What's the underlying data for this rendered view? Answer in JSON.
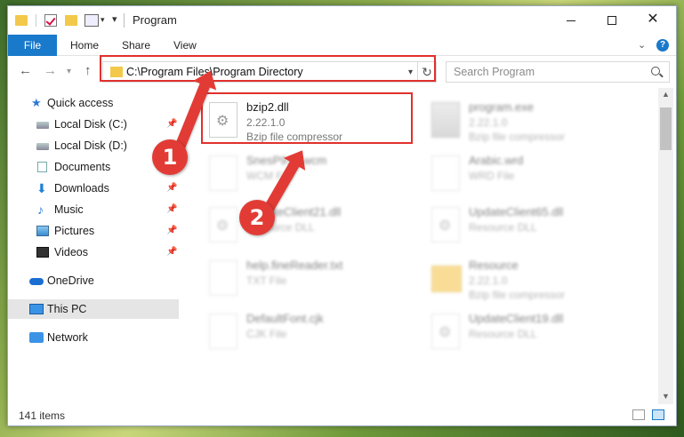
{
  "window": {
    "title": "Program"
  },
  "ribbon": {
    "file": "File",
    "home": "Home",
    "share": "Share",
    "view": "View",
    "help": "?"
  },
  "nav": {
    "address": "C:\\Program Files\\Program Directory",
    "search_placeholder": "Search Program"
  },
  "sidebar": {
    "items": [
      {
        "label": "Quick access",
        "icon": "star-icon",
        "pinned": false
      },
      {
        "label": "Local Disk (C:)",
        "icon": "disk-icon",
        "pinned": true
      },
      {
        "label": "Local Disk (D:)",
        "icon": "disk-icon",
        "pinned": false
      },
      {
        "label": "Documents",
        "icon": "documents-icon",
        "pinned": true
      },
      {
        "label": "Downloads",
        "icon": "download-icon",
        "pinned": true
      },
      {
        "label": "Music",
        "icon": "music-icon",
        "pinned": true
      },
      {
        "label": "Pictures",
        "icon": "pictures-icon",
        "pinned": true
      },
      {
        "label": "Videos",
        "icon": "videos-icon",
        "pinned": true
      },
      {
        "label": "OneDrive",
        "icon": "onedrive-icon",
        "pinned": false
      },
      {
        "label": "This PC",
        "icon": "pc-icon",
        "pinned": false,
        "selected": true
      },
      {
        "label": "Network",
        "icon": "network-icon",
        "pinned": false
      }
    ]
  },
  "files": [
    {
      "name": "bzip2.dll",
      "meta1": "2.22.1.0",
      "meta2": "Bzip file compressor",
      "highlighted": true
    },
    {
      "name": "program.exe",
      "meta1": "2.22.1.0",
      "meta2": "Bzip file compressor"
    },
    {
      "name": "SnesP912.wcm",
      "meta1": "WCM File",
      "meta2": ""
    },
    {
      "name": "Arabic.wrd",
      "meta1": "WRD File",
      "meta2": ""
    },
    {
      "name": "UpdateClient21.dll",
      "meta1": "Resource DLL",
      "meta2": ""
    },
    {
      "name": "UpdateClient65.dll",
      "meta1": "Resource DLL",
      "meta2": ""
    },
    {
      "name": "help.fineReader.txt",
      "meta1": "TXT File",
      "meta2": ""
    },
    {
      "name": "Resource",
      "meta1": "2.22.1.0",
      "meta2": "Bzip file compressor"
    },
    {
      "name": "DefaultFont.cjk",
      "meta1": "CJK File",
      "meta2": ""
    },
    {
      "name": "UpdateClient19.dll",
      "meta1": "Resource DLL",
      "meta2": ""
    }
  ],
  "status": {
    "items": "141 items"
  },
  "annotations": {
    "step1": "1",
    "step2": "2",
    "color": "#e23b35"
  }
}
